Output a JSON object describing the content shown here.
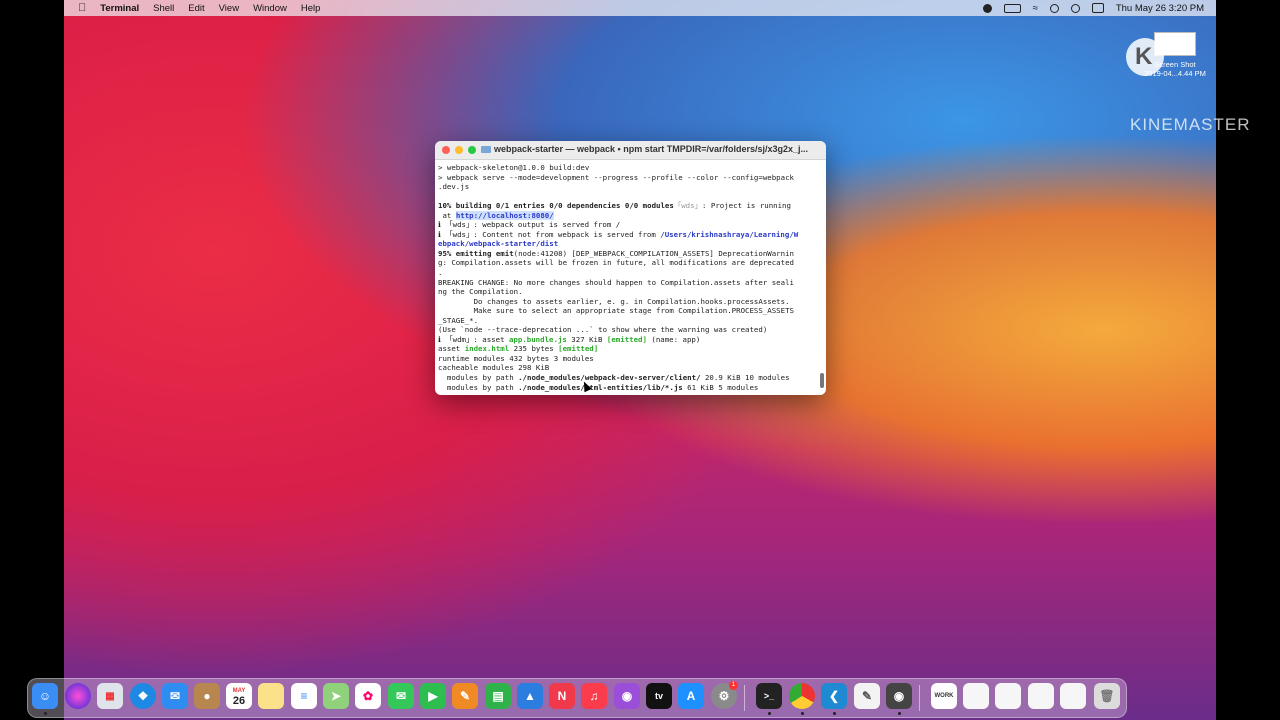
{
  "menubar": {
    "app": "Terminal",
    "items": [
      "Shell",
      "Edit",
      "View",
      "Window",
      "Help"
    ],
    "clock": "Thu May 26  3:20 PM"
  },
  "desktop_icon": {
    "label1": "Screen Shot",
    "label2": "2019-04...4.44 PM"
  },
  "watermark": "KINEMASTER",
  "terminal": {
    "title": "webpack-starter — webpack • npm start TMPDIR=/var/folders/sj/x3g2x_j...",
    "lines": [
      "> webpack-skeleton@1.0.0 build:dev",
      "> webpack serve --mode=development --progress --profile --color --config=webpack",
      ".dev.js",
      "",
      "10% building 0/1 entries 0/0 dependencies 0/0 modules",
      " at ",
      "ℹ 「wds」: webpack output is served from /",
      "ℹ 「wds」: Content not from webpack is served from ",
      "ebpack/webpack-starter/dist",
      "95% emitting emit",
      "g: Compilation.assets will be frozen in future, all modifications are deprecated",
      ".",
      "BREAKING CHANGE: No more changes should happen to Compilation.assets after seali",
      "ng the Compilation.",
      "        Do changes to assets earlier, e. g. in Compilation.hooks.processAssets.",
      "        Make sure to select an appropriate stage from Compilation.PROCESS_ASSETS",
      "_STAGE_*.",
      "(Use `node --trace-deprecation ...` to show where the warning was created)",
      "ℹ 「wdm」: asset ",
      "asset ",
      "runtime modules 432 bytes 3 modules",
      "cacheable modules 298 KiB",
      "  modules by path ",
      "  modules by path "
    ],
    "wds_tag": "「wds」",
    "running_text": ": Project is running",
    "localhost": "http://localhost:8080/",
    "users_path": "/Users/krishnashraya/Learning/W",
    "emit_rest": "(node:41208) [DEP_WEBPACK_COMPILATION_ASSETS] DeprecationWarnin",
    "bundle_name": "app.bundle.js",
    "bundle_rest": " 327 KiB ",
    "emitted": "[emitted]",
    "bundle_tail": " (name: app)",
    "index_name": "index.html",
    "index_rest": " 235 bytes ",
    "path1": "./node_modules/webpack-dev-server/client/",
    "path1_rest": " 20.9 KiB 10 modules",
    "path2": "./node_modules/html-entities/lib/*.js",
    "path2_rest": " 61 KiB 5 modules"
  },
  "dock": {
    "calendar_month": "MAY",
    "calendar_day": "26",
    "badge": "1",
    "apps": [
      "finder-icon",
      "siri-icon",
      "launchpad-icon",
      "safari-icon",
      "mail-icon",
      "contacts-icon",
      "calendar-icon",
      "notes-icon",
      "reminders-icon",
      "maps-icon",
      "photos-icon",
      "messages-icon",
      "facetime-icon",
      "pages-icon",
      "numbers-icon",
      "keynote-icon",
      "news-icon",
      "music-icon",
      "podcasts-icon",
      "tv-icon",
      "app-store-icon",
      "system-preferences-icon",
      "terminal-icon",
      "chrome-icon",
      "vscode-icon",
      "textedit-icon",
      "preview-icon"
    ],
    "colors": {
      "finder": "#3a8df5",
      "safari": "#1e88e5",
      "mail": "#2f8cf0",
      "messages": "#34c759",
      "facetime": "#2dbe4f",
      "pages": "#f08a24",
      "numbers": "#2fb24a",
      "keynote": "#2b7de0",
      "news": "#f0394a",
      "music": "#fa3c4c",
      "podcasts": "#9b4fd8",
      "tv": "#111111",
      "appstore": "#1e90ff",
      "terminal": "#222222",
      "vscode": "#1f8ad2"
    }
  }
}
